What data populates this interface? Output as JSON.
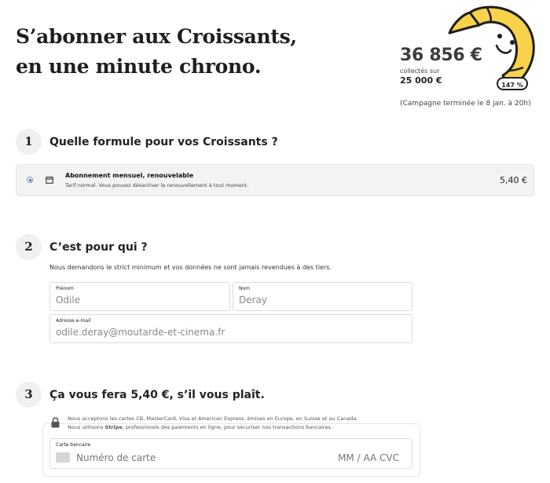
{
  "header": {
    "title_line1": "S’abonner aux Croissants,",
    "title_line2": "en une minute chrono.",
    "collected_amount": "36 856 €",
    "collected_label": "collectés sur",
    "goal_amount": "25 000 €",
    "progress_badge": "147 %",
    "progress_percent": 147,
    "campaign_status": "(Campagne terminée le 8 jan. à 20h)"
  },
  "step1": {
    "number": "1",
    "title": "Quelle formule pour vos Croissants ?",
    "plan": {
      "name": "Abonnement mensuel, renouvelable",
      "description": "Tarif normal. Vous pouvez désactiver le renouvellement à tout moment.",
      "price": "5,40 €",
      "selected": true
    }
  },
  "step2": {
    "number": "2",
    "title": "C’est pour qui ?",
    "help": "Nous demandons le strict minimum et vos données ne sont jamais revendues à des tiers.",
    "firstname": {
      "label": "Prénom",
      "placeholder": "Odile"
    },
    "lastname": {
      "label": "Nom",
      "placeholder": "Deray"
    },
    "email": {
      "label": "Adresse e-mail",
      "placeholder": "odile.deray@moutarde-et-cinema.fr"
    }
  },
  "step3": {
    "number": "3",
    "title": "Ça vous fera 5,40 €, s’il vous plaît.",
    "security_line1": "Nous acceptons les cartes CB, MasterCard, Visa et American Express, émises en Europe, en Suisse et au Canada.",
    "security_line2_prefix": "Nous utilisons ",
    "security_line2_brand": "Stripe",
    "security_line2_suffix": ", professionels des paiements en ligne, pour sécuriser nos transactions bancaires.",
    "card": {
      "label": "Carte bancaire",
      "number_placeholder": "Numéro de carte",
      "expiry_cvc_placeholder": "MM / AA  CVC"
    }
  },
  "colors": {
    "mascot_yellow": "#f7d24a",
    "outline": "#1d1d1d",
    "step_circle": "#f0f0f0",
    "radio_selected": "#3a4f94"
  }
}
